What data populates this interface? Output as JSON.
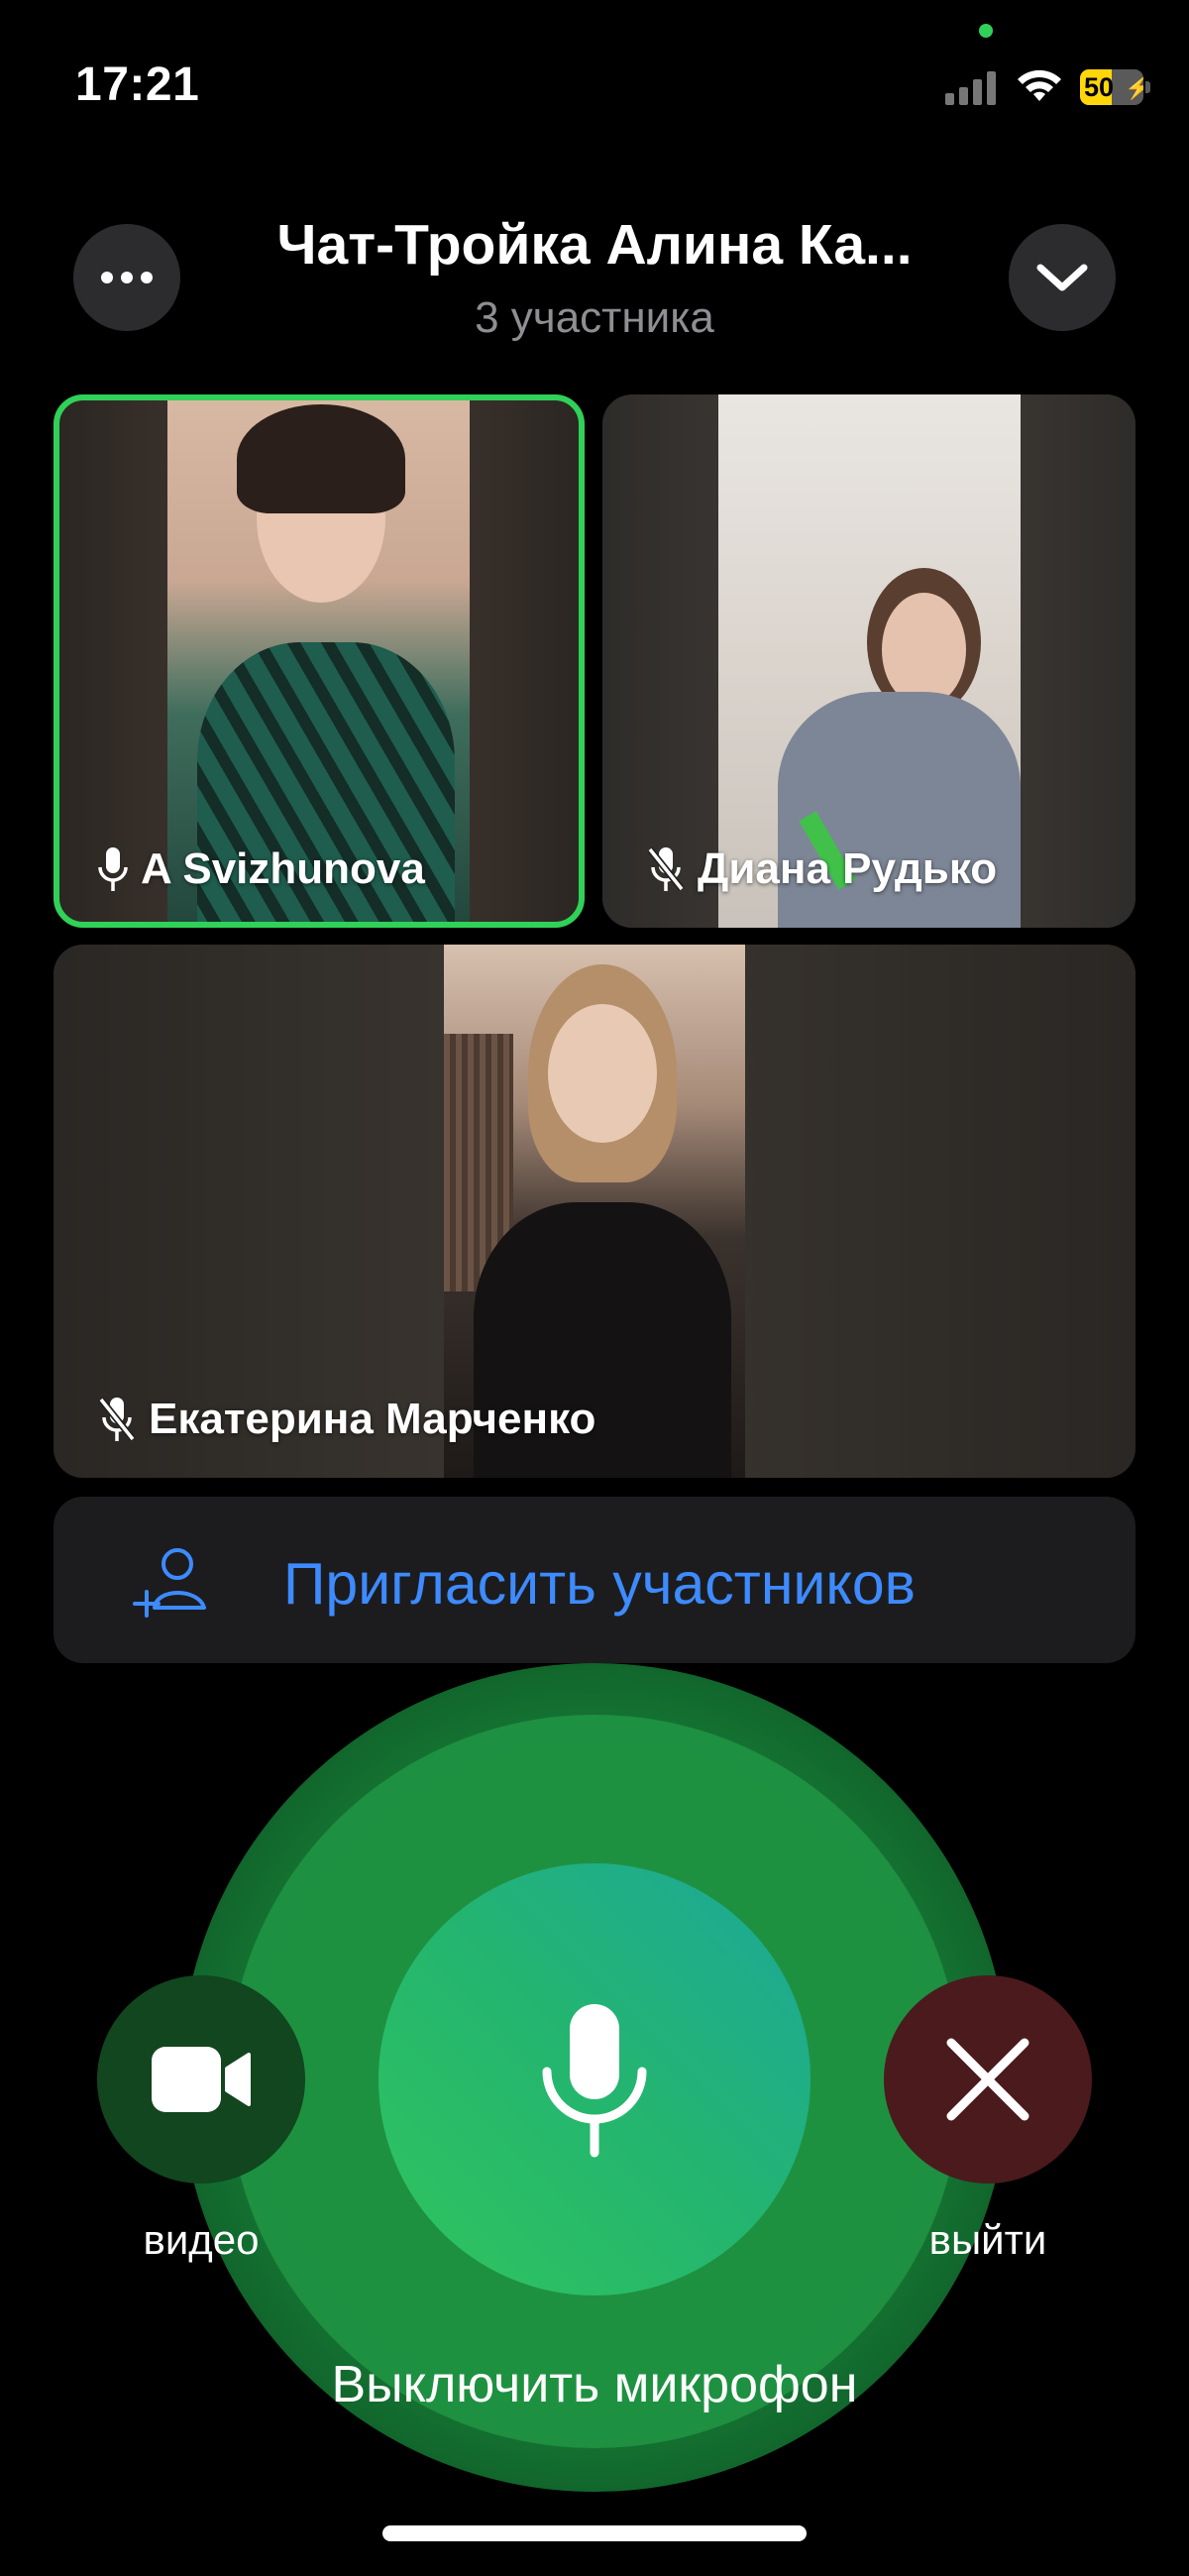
{
  "status_bar": {
    "time": "17:21",
    "battery_level": "50",
    "battery_fraction": 0.5,
    "signal_bars_active": 0,
    "colors": {
      "privacy_dot": "#30d158",
      "battery": "#ffd60a"
    }
  },
  "header": {
    "title": "Чат-Тройка Алина Ка...",
    "subtitle": "3 участника",
    "more_icon": "ellipsis-icon",
    "collapse_icon": "chevron-down-icon"
  },
  "participants": [
    {
      "name": "A Svizhunova",
      "mic": "on",
      "speaking": true
    },
    {
      "name": "Диана Рудько",
      "mic": "muted",
      "speaking": false
    },
    {
      "name": "Екатерина Марченко",
      "mic": "muted",
      "speaking": false
    }
  ],
  "invite": {
    "label": "Пригласить участников",
    "icon": "add-person-icon",
    "color": "#3d8bff"
  },
  "controls": {
    "video_label": "видео",
    "leave_label": "выйти",
    "mute_label": "Выключить микрофон",
    "video_icon": "video-camera-icon",
    "mic_icon": "microphone-icon",
    "leave_icon": "close-icon",
    "colors": {
      "mic": "#30c55d",
      "video_bg": "#11461f",
      "leave_bg": "#4b1a1c"
    }
  }
}
